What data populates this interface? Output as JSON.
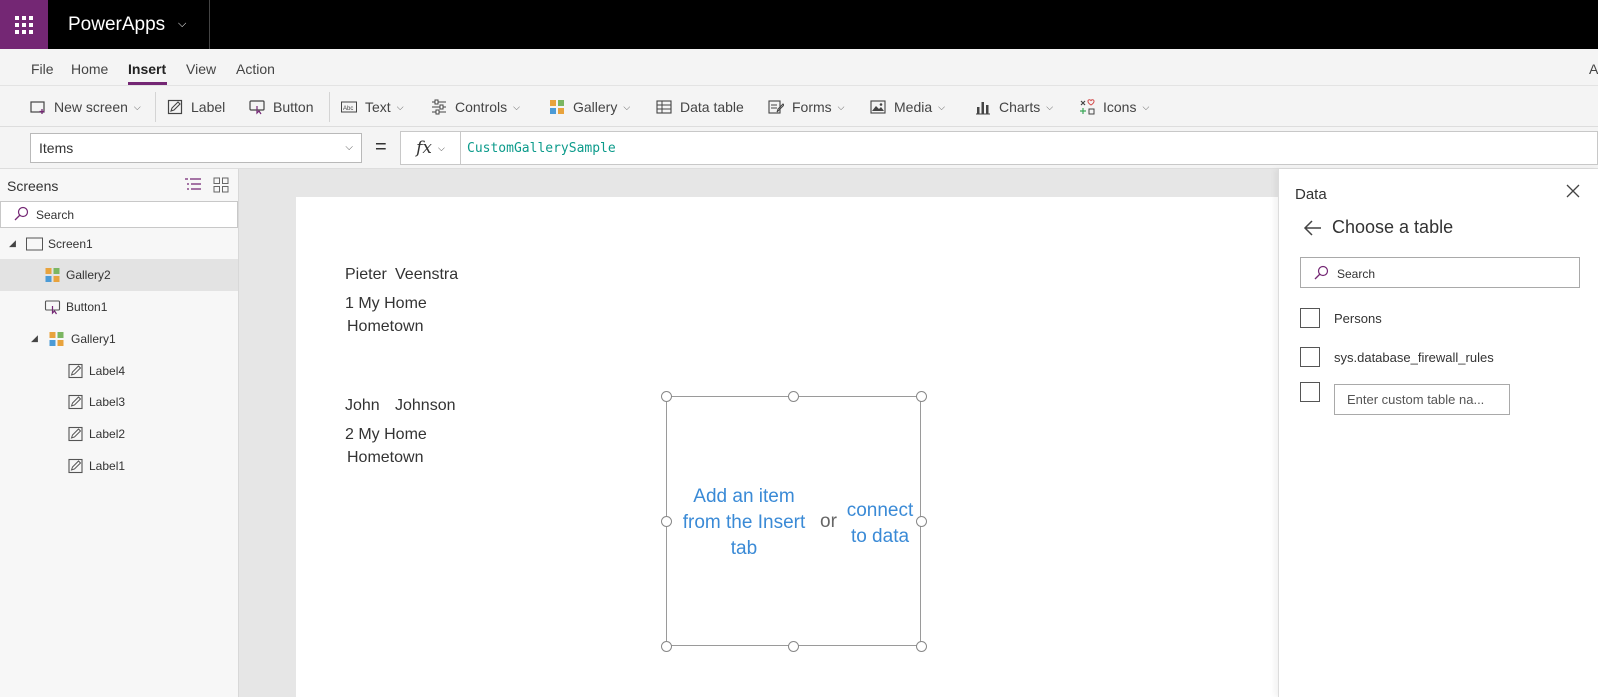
{
  "app": {
    "title": "PowerApps"
  },
  "menu": {
    "items": [
      "File",
      "Home",
      "Insert",
      "View",
      "Action"
    ],
    "active": "Insert",
    "trailing": "A"
  },
  "ribbon": {
    "new_screen": "New screen",
    "label": "Label",
    "button": "Button",
    "text": "Text",
    "controls": "Controls",
    "gallery": "Gallery",
    "data_table": "Data table",
    "forms": "Forms",
    "media": "Media",
    "charts": "Charts",
    "icons": "Icons"
  },
  "formula": {
    "property": "Items",
    "equals": "=",
    "fx": "fx",
    "value": "CustomGallerySample"
  },
  "tree": {
    "title": "Screens",
    "search_placeholder": "Search",
    "items": [
      {
        "label": "Screen1",
        "level": 0,
        "expanded": true,
        "icon": "screen-icon"
      },
      {
        "label": "Gallery2",
        "level": 1,
        "selected": true,
        "icon": "gallery-icon"
      },
      {
        "label": "Button1",
        "level": 1,
        "icon": "button-icon"
      },
      {
        "label": "Gallery1",
        "level": 1,
        "expanded": true,
        "icon": "gallery-icon"
      },
      {
        "label": "Label4",
        "level": 2,
        "icon": "label-icon"
      },
      {
        "label": "Label3",
        "level": 2,
        "icon": "label-icon"
      },
      {
        "label": "Label2",
        "level": 2,
        "icon": "label-icon"
      },
      {
        "label": "Label1",
        "level": 2,
        "icon": "label-icon"
      }
    ]
  },
  "canvas": {
    "records": [
      {
        "first": "Pieter",
        "last": "Veenstra",
        "address": "1 My Home",
        "city": "Hometown"
      },
      {
        "first": "John",
        "last": "Johnson",
        "address": "2 My Home",
        "city": "Hometown"
      }
    ],
    "gallery_prompt": {
      "add_item": "Add an item from the Insert tab",
      "or": "or",
      "connect": "connect to data"
    }
  },
  "data_panel": {
    "title": "Data",
    "subtitle": "Choose a table",
    "search_placeholder": "Search",
    "tables": [
      "Persons",
      "sys.database_firewall_rules"
    ],
    "custom_placeholder": "Enter custom table na..."
  },
  "colors": {
    "brand": "#742774",
    "link": "#3a8ad6",
    "formula_text": "#0c9b8b"
  }
}
